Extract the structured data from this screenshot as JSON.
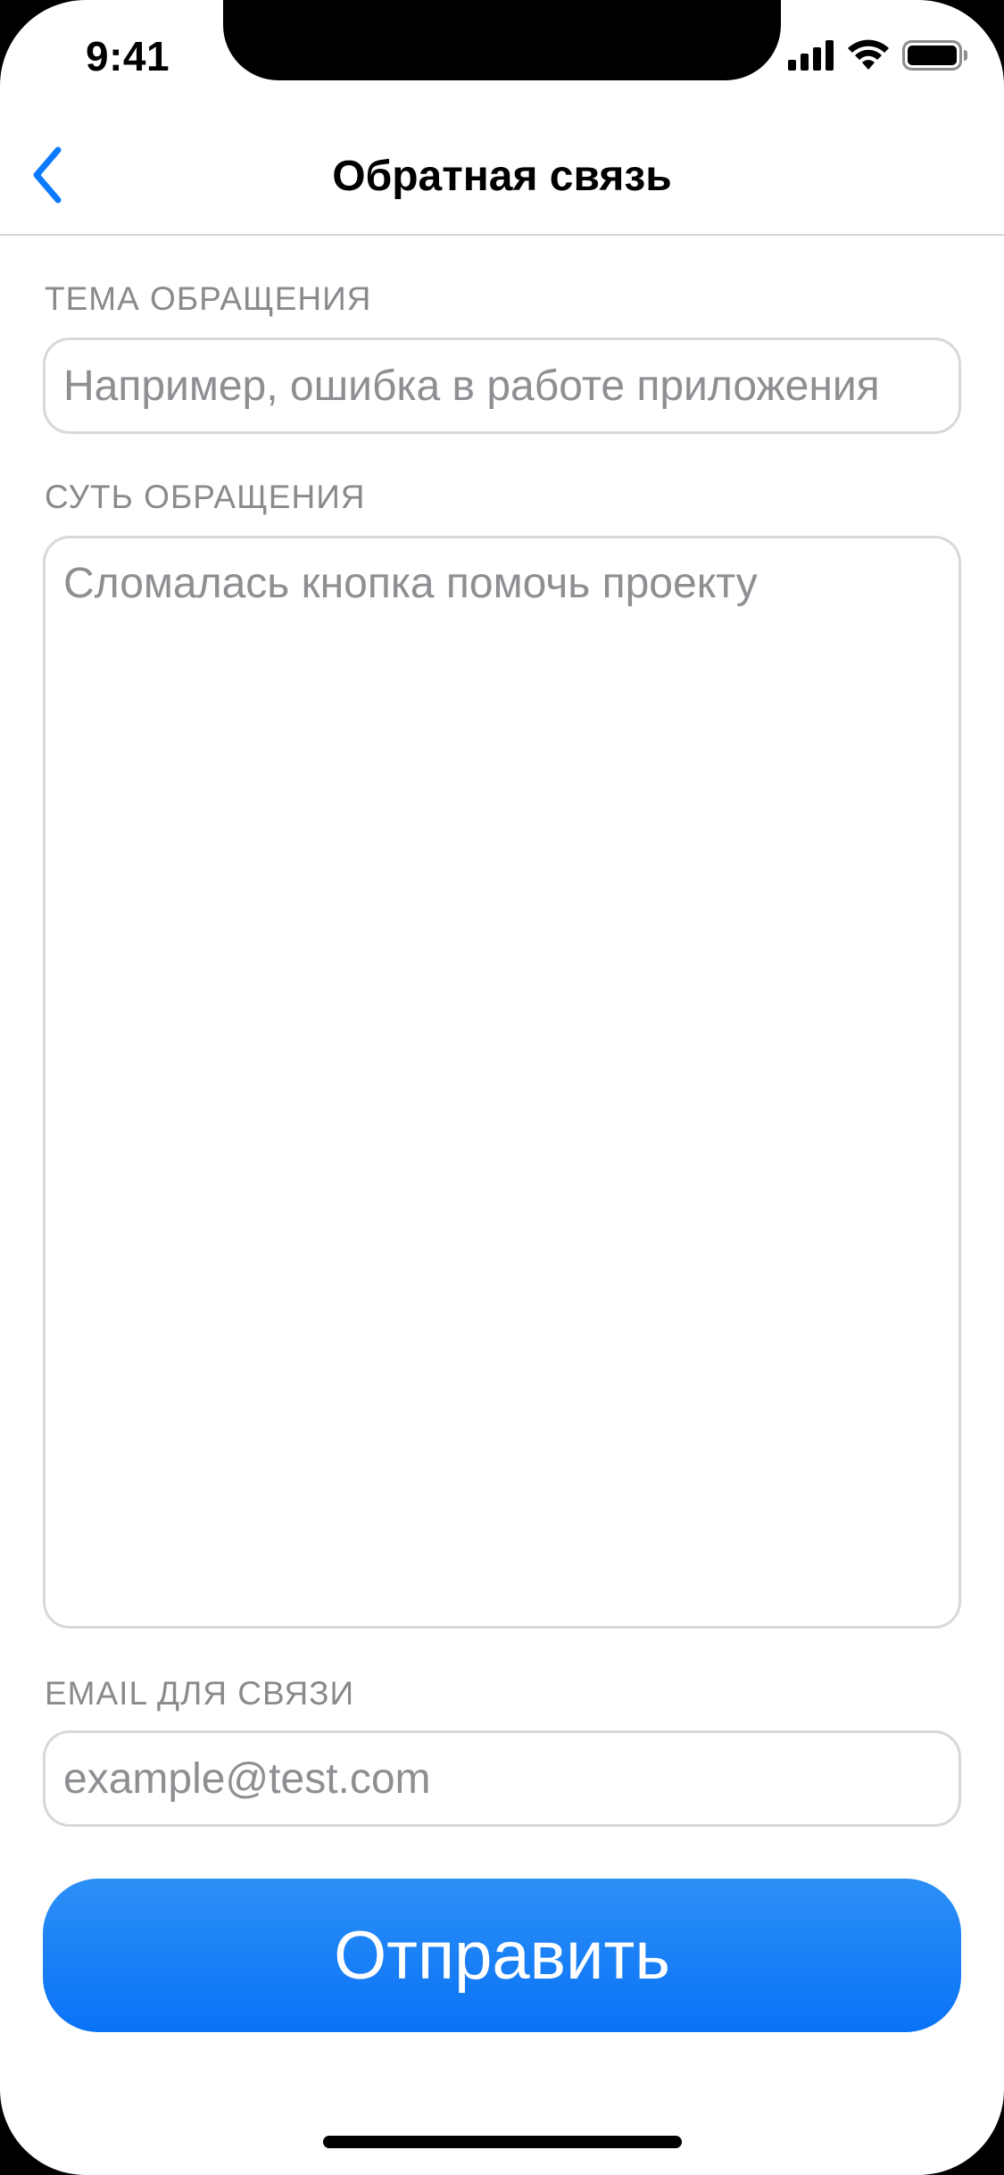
{
  "status_bar": {
    "time": "9:41",
    "icons": [
      "cellular-signal-icon",
      "wifi-icon",
      "battery-icon"
    ]
  },
  "nav": {
    "title": "Обратная связь",
    "back_icon": "chevron-left-icon"
  },
  "form": {
    "subject": {
      "label": "ТЕМА ОБРАЩЕНИЯ",
      "placeholder": "Например, ошибка в работе приложения",
      "value": ""
    },
    "message": {
      "label": "СУТЬ ОБРАЩЕНИЯ",
      "placeholder": "Сломалась кнопка помочь проекту",
      "value": ""
    },
    "email": {
      "label": "EMAIL ДЛЯ СВЯЗИ",
      "placeholder": "example@test.com",
      "value": ""
    }
  },
  "submit": {
    "label": "Отправить"
  },
  "colors": {
    "accent": "#0A7AFF",
    "button_gradient_top": "#2C90F6",
    "button_gradient_bottom": "#0A72F7",
    "label_gray": "#8A8A8E",
    "field_border": "#D8D8DA"
  }
}
